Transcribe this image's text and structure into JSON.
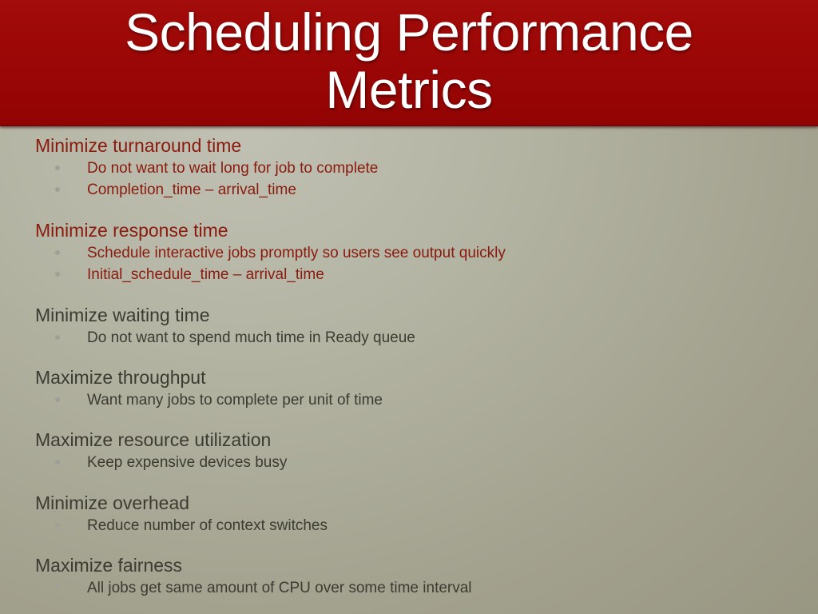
{
  "slide": {
    "title_line1": "Scheduling Performance",
    "title_line2": "Metrics",
    "colors": {
      "title_band": "#990605",
      "title_text": "#ffffff",
      "accent_text": "#8a1a0e",
      "muted_text": "#3b3b32",
      "bullet": "#9ea095",
      "background": "#b3b3a2"
    }
  },
  "sections": [
    {
      "heading": "Minimize turnaround time",
      "style": "accent",
      "bullets": [
        "Do not want to wait long for job to complete",
        "Completion_time – arrival_time"
      ]
    },
    {
      "heading": "Minimize response time",
      "style": "accent",
      "bullets": [
        "Schedule interactive jobs promptly so users see output quickly",
        "Initial_schedule_time – arrival_time"
      ]
    },
    {
      "heading": "Minimize waiting time",
      "style": "muted",
      "bullets": [
        "Do not want to spend much time in Ready queue"
      ]
    },
    {
      "heading": "Maximize throughput",
      "style": "muted",
      "bullets": [
        "Want many jobs to complete per unit of time"
      ]
    },
    {
      "heading": "Maximize resource utilization",
      "style": "muted",
      "bullets": [
        "Keep expensive devices busy"
      ]
    },
    {
      "heading": "Minimize overhead",
      "style": "muted",
      "bullets": [
        "Reduce number of context switches"
      ]
    },
    {
      "heading": "Maximize fairness",
      "style": "muted",
      "bullets": [
        "All jobs get same amount of CPU over some time interval"
      ]
    }
  ]
}
